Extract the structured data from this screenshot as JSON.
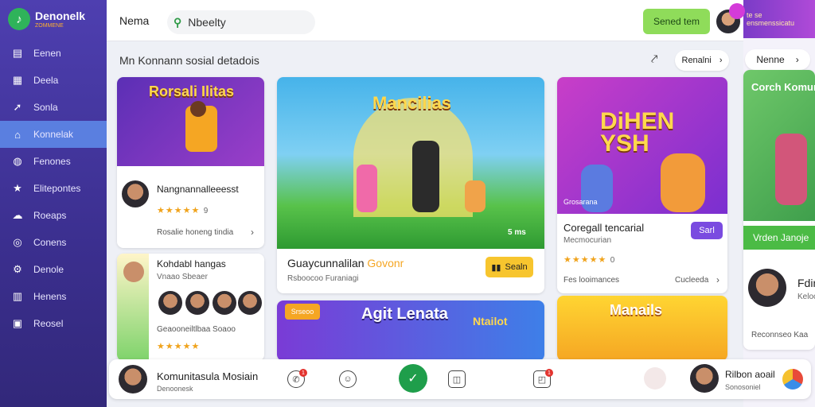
{
  "brand": {
    "name": "Denonelk",
    "sub": "ZOMMENE"
  },
  "sidebar": {
    "items": [
      {
        "label": "Eenen",
        "icon": "file-icon"
      },
      {
        "label": "Deela",
        "icon": "document-icon"
      },
      {
        "label": "Sonla",
        "icon": "share-icon"
      },
      {
        "label": "Konnelak",
        "icon": "home-icon",
        "active": true
      },
      {
        "label": "Fenones",
        "icon": "globe-icon"
      },
      {
        "label": "Elitepontes",
        "icon": "star-icon"
      },
      {
        "label": "Roeaps",
        "icon": "cloud-icon"
      },
      {
        "label": "Conens",
        "icon": "compass-icon"
      },
      {
        "label": "Denole",
        "icon": "settings-icon"
      },
      {
        "label": "Henens",
        "icon": "grid-icon"
      },
      {
        "label": "Reosel",
        "icon": "image-icon"
      }
    ]
  },
  "topbar": {
    "title": "Nema",
    "search_value": "Nbeelty",
    "save_label": "Sened tem"
  },
  "promo": {
    "text": "te se ensmenssicatu"
  },
  "main": {
    "section_title": "Mn Konnann sosial detadois",
    "filter_pill": "Renalni",
    "right_pill": "Nenne",
    "cards": [
      {
        "art_title": "Rorsali Ilitas",
        "name": "Nangnannalleeesst",
        "rating": "9",
        "footer": "Rosalie honeng tindia"
      },
      {
        "art_title": "Mancilias",
        "name": "Guaycunnalilan",
        "name_accent": "Govonr",
        "sub": "Rsboocoo Furaniagi",
        "play_label": "Sealn",
        "badge": "5 ms"
      },
      {
        "art_title": "DiHEN YSH",
        "art_caption": "Grosarana",
        "name": "Coregall tencarial",
        "sub": "Mecmocurian",
        "tag": "Sarl",
        "rating": "0",
        "footer_left": "Fes looimances",
        "footer_right": "Cucleeda"
      },
      {
        "art_title": "Corch Komuna",
        "button": "Vrden Janoje",
        "name": "Fdin",
        "name2": "Kelocl",
        "footer": "Reconnseo Kaa"
      },
      {
        "name": "Kohdabl hangas",
        "sub": "Vnaao Sbeaer",
        "footer": "Geaooneiltlbaa Soaoo"
      },
      {
        "art_title": "Agit Lenata",
        "chip": "Srseoo",
        "sign": "Ntailot"
      },
      {
        "art_title": "Manails"
      }
    ]
  },
  "bottombar": {
    "name": "Komunitasula Mosiain",
    "sub": "Denoonesk",
    "right_name": "Rilbon aoail",
    "right_sub": "Sonosoniel"
  },
  "colors": {
    "sidebar": "#3b2f8f",
    "active": "#5a7fe0",
    "accent_green": "#8fdc5a",
    "play": "#1f9e4b"
  }
}
